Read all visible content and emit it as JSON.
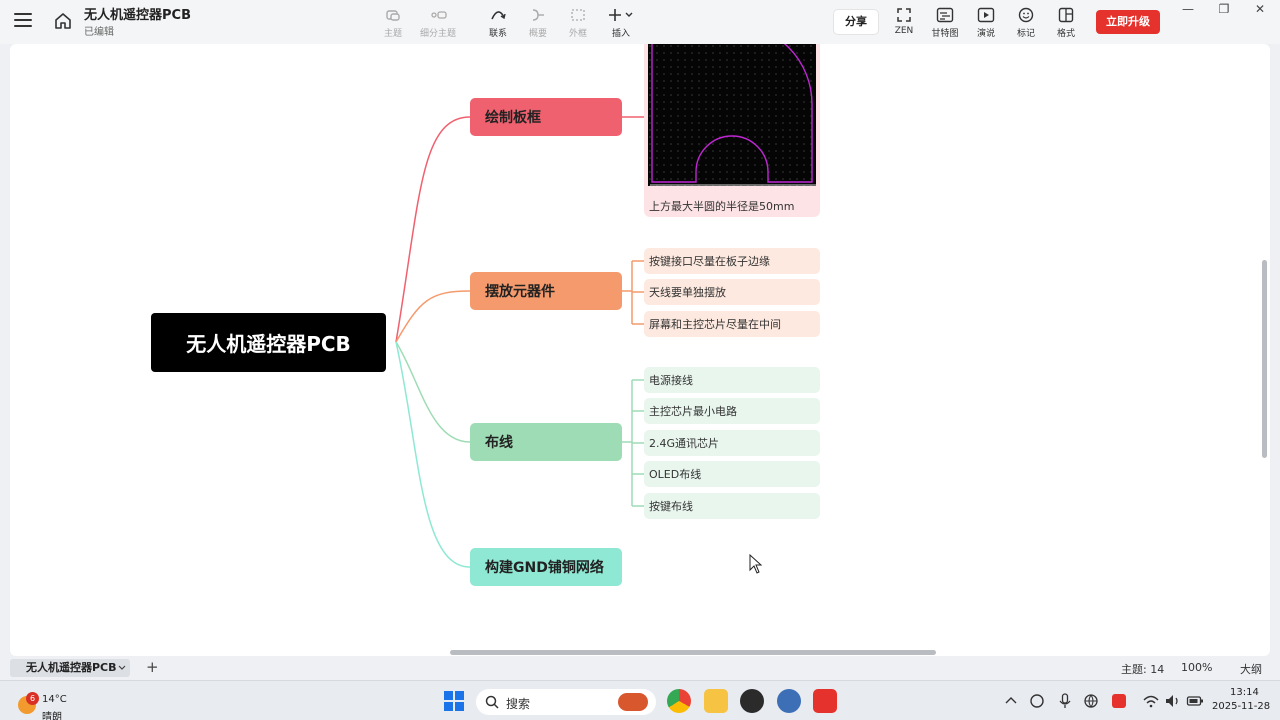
{
  "app": {
    "doc_title": "无人机遥控器PCB",
    "doc_status": "已编辑"
  },
  "toolbar": {
    "tools": [
      {
        "label": "主题",
        "icon": "topic-icon",
        "enabled": false
      },
      {
        "label": "细分主题",
        "icon": "subtopic-icon",
        "enabled": false
      },
      {
        "label": "联系",
        "icon": "relationship-icon",
        "enabled": true
      },
      {
        "label": "概要",
        "icon": "summary-icon",
        "enabled": false
      },
      {
        "label": "外框",
        "icon": "boundary-icon",
        "enabled": false
      },
      {
        "label": "插入",
        "icon": "insert-icon",
        "enabled": true
      }
    ],
    "share_label": "分享",
    "right_tools": [
      {
        "label": "ZEN",
        "icon": "zen-icon"
      },
      {
        "label": "甘特图",
        "icon": "gantt-icon"
      },
      {
        "label": "演说",
        "icon": "pitch-icon"
      },
      {
        "label": "标记",
        "icon": "marker-icon"
      },
      {
        "label": "格式",
        "icon": "format-icon"
      }
    ],
    "upgrade_label": "立即升级"
  },
  "window_controls": [
    "—",
    "❐",
    "✕"
  ],
  "mindmap": {
    "root": "无人机遥控器PCB",
    "branches": [
      {
        "label": "绘制板框",
        "color": "#f0616f",
        "leaf_bg": "#fde3e6",
        "image_caption": "上方最大半圆的半径是50mm"
      },
      {
        "label": "摆放元器件",
        "color": "#f49a6c",
        "leaf_bg": "#fde9df",
        "children": [
          "按键接口尽量在板子边缘",
          "天线要单独摆放",
          "屏幕和主控芯片尽量在中间"
        ]
      },
      {
        "label": "布线",
        "color": "#9edcb5",
        "leaf_bg": "#e9f6ee",
        "children": [
          "电源接线",
          "主控芯片最小电路",
          "2.4G通讯芯片",
          "OLED布线",
          "按键布线"
        ]
      },
      {
        "label": "构建GND铺铜网络",
        "color": "#8ee8d3",
        "leaf_bg": "#e4f9f3"
      }
    ]
  },
  "sheet": {
    "tab_label": "无人机遥控器PCB",
    "add_label": "+",
    "topic_count": "主题: 14",
    "zoom": "100%",
    "view_label": "大纲"
  },
  "taskbar": {
    "weather_badge": "6",
    "temperature": "14°C",
    "condition": "晴朗",
    "search_label": "搜索",
    "time": "13:14",
    "date": "2025-11-28"
  }
}
